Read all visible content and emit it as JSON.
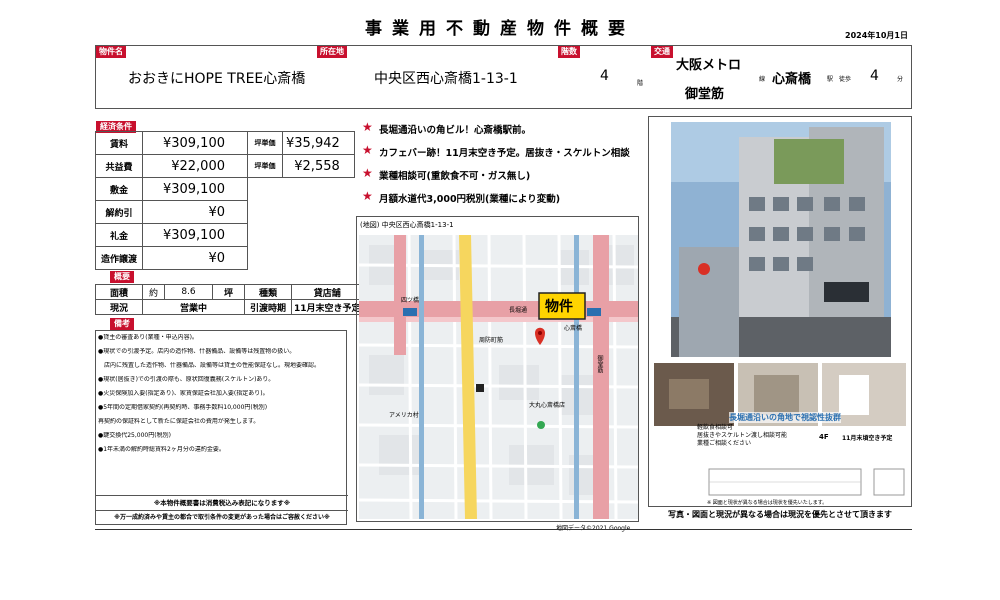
{
  "header": {
    "title": "事業用不動産物件概要",
    "date": "2024年10月1日"
  },
  "info": {
    "name_label": "物件名",
    "name": "おおきにHOPE TREE心斎橋",
    "addr_label": "所在地",
    "address": "中央区西心斎橋1-13-1",
    "floor_label": "階数",
    "floor": "4",
    "floor_unit": "階",
    "traffic_label": "交通",
    "line_name_1": "大阪メトロ",
    "line_name_2": "御堂筋",
    "line_suffix": "線",
    "station": "心斎橋",
    "station_suffix": "駅",
    "walk_label": "徒歩",
    "walk_minutes": "4",
    "walk_unit": "分"
  },
  "finance": {
    "label": "経済条件",
    "rows": [
      {
        "k": "賃料",
        "v": "¥309,100",
        "k2": "坪単価",
        "v2": "¥35,942"
      },
      {
        "k": "共益費",
        "v": "¥22,000",
        "k2": "坪単価",
        "v2": "¥2,558"
      },
      {
        "k": "敷金",
        "v": "¥309,100"
      },
      {
        "k": "解約引",
        "v": "¥0"
      },
      {
        "k": "礼金",
        "v": "¥309,100"
      },
      {
        "k": "造作譲渡",
        "v": "¥0"
      }
    ]
  },
  "overview": {
    "label": "概要",
    "area_label": "面積",
    "area_approx": "約",
    "area_value": "8.6",
    "area_unit": "坪",
    "type_label": "種類",
    "type_value": "貸店舗",
    "status_label": "現況",
    "status_value": "営業中",
    "handover_label": "引渡時期",
    "handover_value": "11月末空き予定"
  },
  "notes": {
    "label": "備考",
    "items": [
      "●貸主の審査あり(業種・申込内容)。",
      "●現状での引渡予定。店内の造作物、什器備品、設備等は残置物の扱い。",
      "　店内に残置した造作物、什器備品、設備等は貸主の性能保証なし。現地要確認。",
      "●現状(居抜き)での引渡の際も、原状回復義務(スケルトン)あり。",
      "●火災保険加入要(指定あり)、家賃保証会社加入要(指定あり)。",
      "●5年間の定期借家契約(再契約時、事務手数料10,000円(税別)",
      "再契約の保証料として新たに保証会社の費用が発生します。",
      "●鍵交換代25,000円(税別)",
      "●1年未満の解約時総賃料2ヶ月分の違約金要。"
    ],
    "footer_1": "※本物件概要書は消費税込み表記になります※",
    "footer_2": "※万一成約済みや賃主の都合で取引条件の変更があった場合はご容赦ください※"
  },
  "features": [
    "長堀通沿いの角ビル！心斎橋駅前。",
    "カフェバー跡！11月末空き予定。居抜き・スケルトン相談",
    "業種相談可(重飲食不可・ガス無し)",
    "月額水道代3,000円税別(業種により変動)"
  ],
  "map": {
    "header": "(地図) 中央区西心斎橋1-13-1",
    "marker": "物件",
    "copyright": "地図データ©2021 Google",
    "street_labels": [
      "長堀通",
      "御堂筋",
      "周防町筋",
      "心斎橋",
      "四ツ橋",
      "大丸心斎橋店",
      "アメリカ村"
    ]
  },
  "photos": {
    "caption": "写真・図面と現況が異なる場合は現況を優先とさせて頂きます",
    "floor_banner": "長堀通沿いの角地で視認性抜群",
    "floor_sub1": "軽飲食相談可",
    "floor_sub2": "居抜きやスケルトン渡し相談可能",
    "floor_sub3": "業種ご相談ください",
    "floor_label": "4F",
    "floor_note": "11月末頃空き予定",
    "floor_disclaimer": "※ 図面と現状が異なる場合は現状を優先いたします。"
  },
  "colors": {
    "accent": "#c8102e",
    "map_road": "#ffffff",
    "map_red": "#e8a0a6"
  }
}
